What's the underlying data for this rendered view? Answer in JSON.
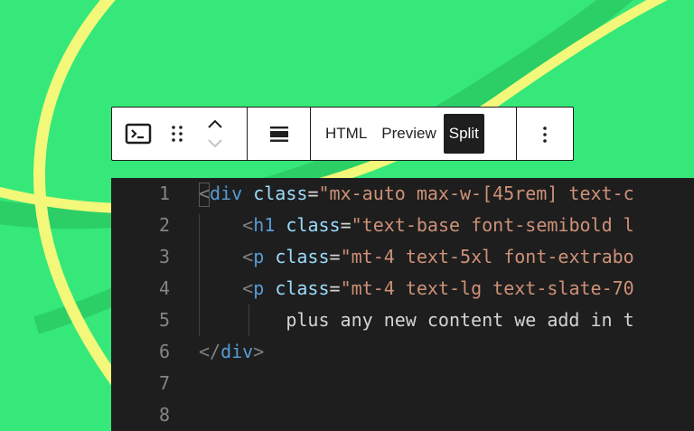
{
  "toolbar": {
    "block_icon": "terminal-code-icon",
    "drag_icon": "drag-handle-icon",
    "move_up_icon": "chevron-up-icon",
    "move_down_icon": "chevron-down-icon",
    "align_icon": "align-center-icon",
    "modes": [
      "HTML",
      "Preview",
      "Split"
    ],
    "active_mode": "Split",
    "more_icon": "more-vertical-icon"
  },
  "editor": {
    "lines": [
      {
        "number": "1",
        "tokens": [
          [
            "punct",
            "<"
          ],
          [
            "tag",
            "div"
          ],
          [
            "text",
            " "
          ],
          [
            "attr",
            "class"
          ],
          [
            "eq",
            "="
          ],
          [
            "str",
            "\"mx-auto max-w-[45rem] text-c"
          ]
        ]
      },
      {
        "number": "2",
        "tokens": [
          [
            "text",
            "    "
          ],
          [
            "punct",
            "<"
          ],
          [
            "tag",
            "h1"
          ],
          [
            "text",
            " "
          ],
          [
            "attr",
            "class"
          ],
          [
            "eq",
            "="
          ],
          [
            "str",
            "\"text-base font-semibold l"
          ]
        ]
      },
      {
        "number": "3",
        "tokens": [
          [
            "text",
            "    "
          ],
          [
            "punct",
            "<"
          ],
          [
            "tag",
            "p"
          ],
          [
            "text",
            " "
          ],
          [
            "attr",
            "class"
          ],
          [
            "eq",
            "="
          ],
          [
            "str",
            "\"mt-4 text-5xl font-extrabo"
          ]
        ]
      },
      {
        "number": "4",
        "tokens": [
          [
            "text",
            "    "
          ],
          [
            "punct",
            "<"
          ],
          [
            "tag",
            "p"
          ],
          [
            "text",
            " "
          ],
          [
            "attr",
            "class"
          ],
          [
            "eq",
            "="
          ],
          [
            "str",
            "\"mt-4 text-lg text-slate-70"
          ]
        ]
      },
      {
        "number": "5",
        "tokens": [
          [
            "text",
            "        plus any new content we add in t"
          ]
        ]
      },
      {
        "number": "6",
        "tokens": [
          [
            "punct",
            "</"
          ],
          [
            "tag",
            "div"
          ],
          [
            "punct",
            ">"
          ]
        ]
      },
      {
        "number": "7",
        "tokens": []
      },
      {
        "number": "8",
        "tokens": []
      }
    ]
  },
  "colors": {
    "background": "#35e879",
    "curve_yellow": "#f3f77a",
    "curve_dark_green": "#2bcf66",
    "editor_bg": "#1e1e1e",
    "tag": "#569cd6",
    "attr": "#9cdcfe",
    "string": "#ce9178"
  }
}
